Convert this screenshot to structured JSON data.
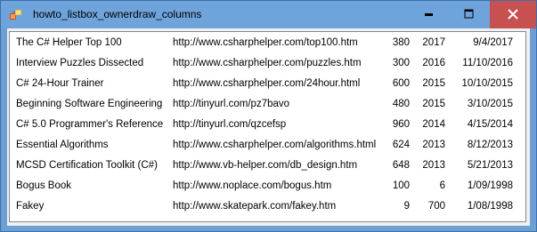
{
  "window": {
    "title": "howto_listbox_ownerdraw_columns",
    "icon": "app-icon",
    "controls": {
      "minimize_icon": "minimize-icon",
      "maximize_icon": "maximize-icon",
      "close_icon": "close-icon",
      "close_hover_color": "#c75050"
    }
  },
  "listbox": {
    "rows": [
      {
        "title": "The C# Helper Top 100",
        "url": "http://www.csharphelper.com/top100.htm",
        "pages": "380",
        "year": "2017",
        "date": "9/4/2017"
      },
      {
        "title": "Interview Puzzles Dissected",
        "url": "http://www.csharphelper.com/puzzles.htm",
        "pages": "300",
        "year": "2016",
        "date": "11/10/2016"
      },
      {
        "title": "C# 24-Hour Trainer",
        "url": "http://www.csharphelper.com/24hour.html",
        "pages": "600",
        "year": "2015",
        "date": "10/10/2015"
      },
      {
        "title": "Beginning Software Engineering",
        "url": "http://tinyurl.com/pz7bavo",
        "pages": "480",
        "year": "2015",
        "date": "3/10/2015"
      },
      {
        "title": "C# 5.0 Programmer's Reference",
        "url": "http://tinyurl.com/qzcefsp",
        "pages": "960",
        "year": "2014",
        "date": "4/15/2014"
      },
      {
        "title": "Essential Algorithms",
        "url": "http://www.csharphelper.com/algorithms.html",
        "pages": "624",
        "year": "2013",
        "date": "8/12/2013"
      },
      {
        "title": "MCSD Certification Toolkit (C#)",
        "url": "http://www.vb-helper.com/db_design.htm",
        "pages": "648",
        "year": "2013",
        "date": "5/21/2013"
      },
      {
        "title": "Bogus Book",
        "url": "http://www.noplace.com/bogus.htm",
        "pages": "100",
        "year": "6",
        "date": "1/09/1998"
      },
      {
        "title": "Fakey",
        "url": "http://www.skatepark.com/fakey.htm",
        "pages": "9",
        "year": "700",
        "date": "1/08/1998"
      }
    ]
  }
}
